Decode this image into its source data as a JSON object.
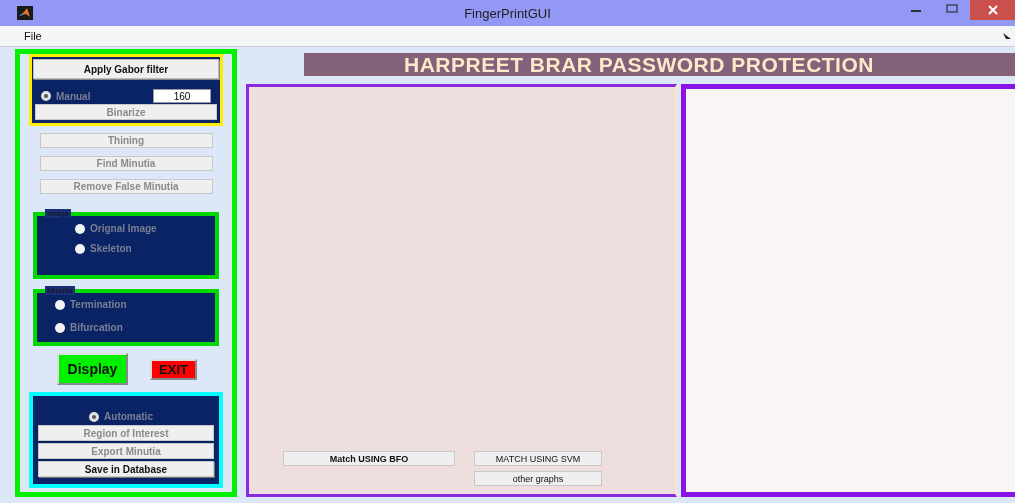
{
  "window": {
    "title": "FingerPrintGUI"
  },
  "menu": [
    {
      "label": "File"
    }
  ],
  "gabor_group": {
    "apply_button": {
      "label": "Apply Gabor filter",
      "disabled": false
    },
    "radio": {
      "label": "Manual",
      "selected": true,
      "disabled": true
    },
    "threshold": "160",
    "binarize_button": {
      "label": "Binarize",
      "disabled": true
    }
  },
  "steps": [
    {
      "label": "Thining",
      "disabled": true
    },
    {
      "label": "Find Minutia",
      "disabled": true
    },
    {
      "label": "Remove False Minutia",
      "disabled": true
    }
  ],
  "image_group": {
    "title": "Image",
    "options": [
      {
        "label": "Orignal Image",
        "selected": false,
        "disabled": true
      },
      {
        "label": "Skeleton",
        "selected": false,
        "disabled": true
      }
    ]
  },
  "minutia_group": {
    "title": "Minutia",
    "options": [
      {
        "label": "Termination",
        "selected": false,
        "disabled": true
      },
      {
        "label": "Bifurcation",
        "selected": false,
        "disabled": true
      }
    ]
  },
  "actions": [
    {
      "label": "Display",
      "kind": "display"
    },
    {
      "label": "EXIT",
      "kind": "exit"
    }
  ],
  "database_group": {
    "radio": {
      "label": "Automatic",
      "selected": true,
      "disabled": true
    },
    "buttons": [
      {
        "label": "Region of Interest",
        "disabled": true
      },
      {
        "label": "Export Minutia",
        "disabled": true
      },
      {
        "label": "Save in Database",
        "disabled": false
      }
    ]
  },
  "banner": "HARPREET BRAR PASSWORD PROTECTION",
  "match_buttons": [
    {
      "label": "Match USING BFO",
      "bold": true
    },
    {
      "label": "MATCH USING SVM",
      "bold": false
    },
    {
      "label": "other graphs",
      "bold": false
    }
  ]
}
